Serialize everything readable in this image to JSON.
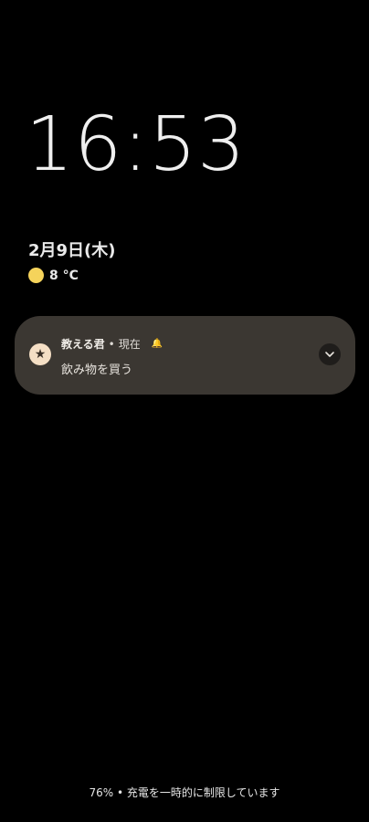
{
  "lockscreen": {
    "time": "16:53",
    "date": "2月9日(木)",
    "weather": {
      "icon": "sun-icon",
      "temperature": "8 °C"
    }
  },
  "notification": {
    "app_name": "教える君",
    "separator": "•",
    "time": "現在",
    "icon": "star-icon",
    "bell_icon": "bell-icon",
    "message": "飲み物を買う",
    "expand_icon": "chevron-down-icon"
  },
  "status": {
    "text": "76% • 充電を一時的に制限しています"
  },
  "colors": {
    "background": "#000000",
    "notification_bg": "#3b3732",
    "app_icon_bg": "#f5dfc5",
    "sun": "#f5d35b"
  }
}
